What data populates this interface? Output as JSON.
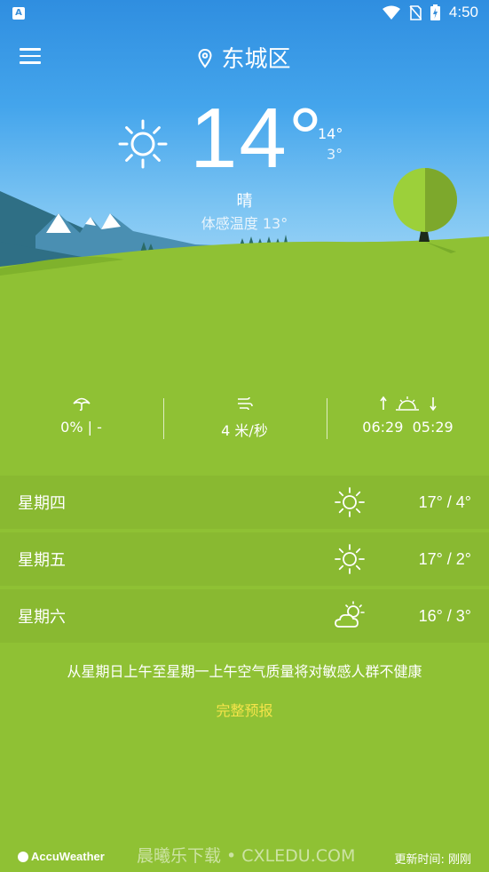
{
  "status_bar": {
    "app_icon": "A",
    "time": "4:50",
    "icons": [
      "wifi-icon",
      "no-sim-icon",
      "battery-charging-icon"
    ]
  },
  "header": {
    "location": "东城区"
  },
  "current": {
    "temperature": "14°",
    "high": "14°",
    "low": "3°",
    "condition": "晴",
    "feels_like": "体感温度 13°",
    "icon": "sun-icon"
  },
  "stats": {
    "precipitation": {
      "icon": "umbrella-icon",
      "value": "0% | -"
    },
    "wind": {
      "icon": "wind-icon",
      "value": "4 米/秒"
    },
    "sun": {
      "icon": "sunrise-sunset-icon",
      "sunrise": "06:29",
      "sunset": "05:29"
    }
  },
  "forecast": [
    {
      "day": "星期四",
      "icon": "sun-icon",
      "range": "17° / 4°"
    },
    {
      "day": "星期五",
      "icon": "sun-icon",
      "range": "17° / 2°"
    },
    {
      "day": "星期六",
      "icon": "partly-cloudy-icon",
      "range": "16° / 3°"
    }
  ],
  "alert": "从星期日上午至星期一上午空气质量将对敏感人群不健康",
  "full_forecast_link": "完整预报",
  "footer": {
    "brand": "AccuWeather",
    "watermark": "晨曦乐下载 • CXLEDU.COM",
    "updated": "更新时间:  刚刚"
  },
  "colors": {
    "sky_top": "#2f8ee0",
    "grass": "#8fc134",
    "link": "#f5e44a"
  }
}
